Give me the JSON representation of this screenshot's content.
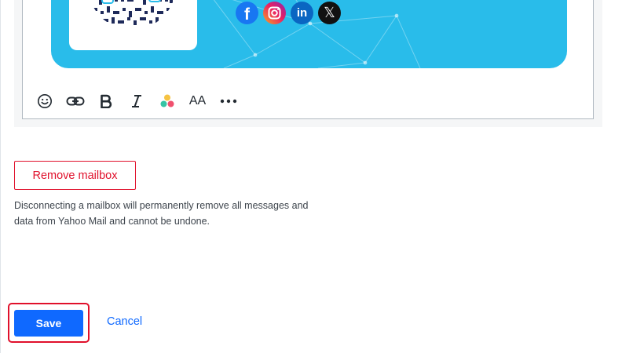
{
  "signature_editor": {
    "social_icons": [
      {
        "icon": "facebook-icon",
        "glyph": "f"
      },
      {
        "icon": "instagram-icon",
        "glyph": ""
      },
      {
        "icon": "linkedin-icon",
        "glyph": "in"
      },
      {
        "icon": "x-icon",
        "glyph": "𝕏"
      }
    ],
    "banner_color": "#29bcea",
    "toolbar": [
      {
        "icon": "emoji-icon"
      },
      {
        "icon": "link-icon"
      },
      {
        "icon": "bold-icon"
      },
      {
        "icon": "italic-icon"
      },
      {
        "icon": "color-palette-icon"
      },
      {
        "icon": "font-size-icon",
        "text": "AA"
      },
      {
        "icon": "more-icon"
      }
    ]
  },
  "remove_mailbox": {
    "button_label": "Remove mailbox",
    "warning_line1": "Disconnecting a mailbox will permanently remove all messages and",
    "warning_line2": "data from Yahoo Mail and cannot be undone."
  },
  "actions": {
    "save_label": "Save",
    "cancel_label": "Cancel"
  },
  "colors": {
    "primary": "#0f69ff",
    "danger": "#e0102b"
  }
}
